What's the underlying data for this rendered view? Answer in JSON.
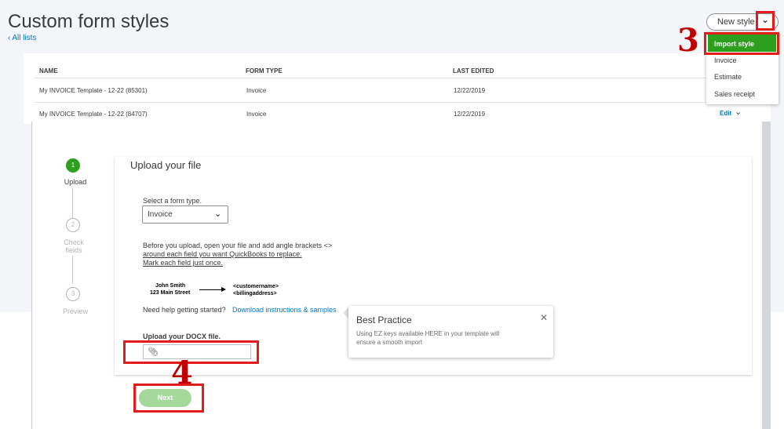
{
  "page": {
    "title": "Custom form styles",
    "back_link": "All lists"
  },
  "new_style": {
    "label": "New style",
    "menu": [
      "Import style",
      "Invoice",
      "Estimate",
      "Sales receipt"
    ],
    "active_item": "Import style"
  },
  "table": {
    "columns": [
      "NAME",
      "FORM TYPE",
      "LAST EDITED"
    ],
    "rows": [
      {
        "name": "My INVOICE Template - 12-22 (85301)",
        "form_type": "Invoice",
        "last_edited": "12/22/2019"
      },
      {
        "name": "My INVOICE Template - 12-22 (84707)",
        "form_type": "Invoice",
        "last_edited": "12/22/2019",
        "action": "Edit"
      }
    ]
  },
  "annotations": {
    "step3": "3",
    "step4": "4"
  },
  "wizard": {
    "steps": [
      {
        "number": "1",
        "label": "Upload",
        "active": true
      },
      {
        "number": "2",
        "label": "Check fields",
        "active": false
      },
      {
        "number": "3",
        "label": "Preview",
        "active": false
      }
    ],
    "card_title": "Upload your file",
    "select_label": "Select a form type.",
    "select_value": "Invoice",
    "instructions": [
      "Before you upload, open your file and add angle brackets <>",
      "around each field you want QuickBooks to replace.",
      "Mark each field just once."
    ],
    "example": {
      "left": [
        "John Smith",
        "123 Main Street"
      ],
      "right": [
        "<customername>",
        "<billingaddress>"
      ]
    },
    "help_text": "Need help getting started?",
    "help_link": "Download instructions & samples",
    "upload_label": "Upload your DOCX file.",
    "next_label": "Next"
  },
  "tooltip": {
    "title": "Best Practice",
    "body": [
      "Using EZ keys available HERE in your template will",
      "ensure a smooth import"
    ]
  },
  "colors": {
    "accent_green": "#2ca01c",
    "link_blue": "#0077c5",
    "annotation_red": "#e31b1b"
  }
}
